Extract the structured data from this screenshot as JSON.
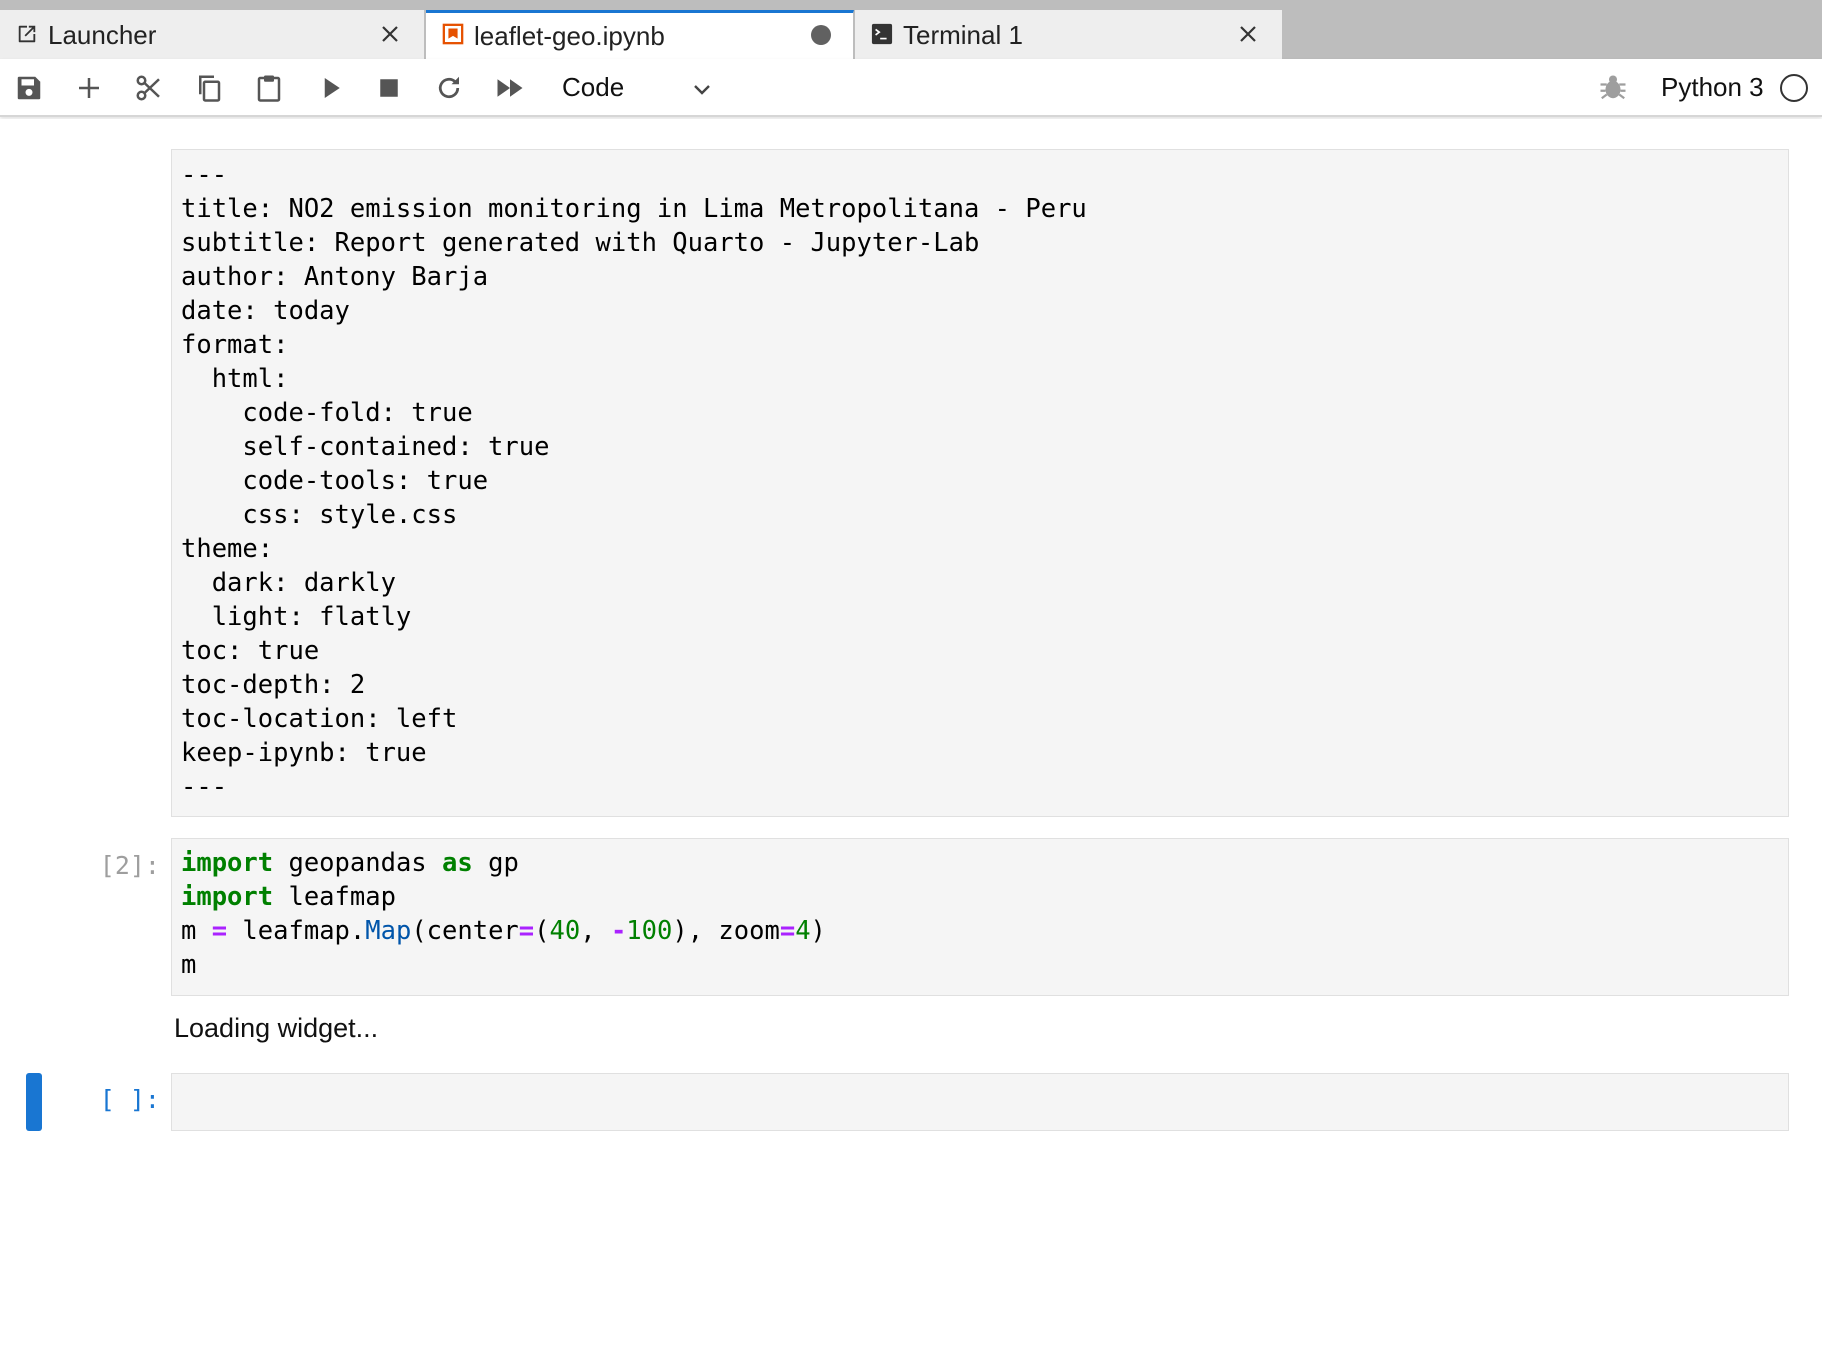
{
  "tabs": [
    {
      "label": "Launcher",
      "icon": "launcher-icon",
      "active": false,
      "closable": true
    },
    {
      "label": "leaflet-geo.ipynb",
      "icon": "notebook-icon",
      "active": true,
      "modified": true
    },
    {
      "label": "Terminal 1",
      "icon": "terminal-icon",
      "active": false,
      "closable": true
    }
  ],
  "toolbar": {
    "cell_type": "Code",
    "kernel_name": "Python 3"
  },
  "cells": {
    "markdown_yaml": {
      "lines": [
        "---",
        "title: NO2 emission monitoring in Lima Metropolitana - Peru",
        "subtitle: Report generated with Quarto - Jupyter-Lab",
        "author: Antony Barja",
        "date: today",
        "format:",
        "  html:",
        "    code-fold: true",
        "    self-contained: true",
        "    code-tools: true",
        "    css: style.css",
        "theme:",
        "  dark: darkly",
        "  light: flatly",
        "toc: true",
        "toc-depth: 2",
        "toc-location: left",
        "keep-ipynb: true",
        "---"
      ]
    },
    "code_cell": {
      "prompt": "[2]:",
      "tokens": {
        "import_kw": "import",
        "geopandas": " geopandas ",
        "as_kw": "as",
        "gp": " gp",
        "leafmap": " leafmap",
        "m": "m ",
        "eq": "=",
        "leafmap_dot": " leafmap.",
        "map_fn": "Map",
        "center_open": "(center",
        "paren_open": "(",
        "n40": "40",
        "comma": ", ",
        "minus": "-",
        "n100": "100",
        "zoom_part": "), zoom",
        "n4": "4",
        "close": ")",
        "m_last": "m"
      },
      "output": "Loading widget..."
    },
    "empty_cell": {
      "prompt": "[ ]:"
    }
  },
  "colors": {
    "accent": "#1976d2",
    "keyword": "#008000",
    "operator": "#aa22ff",
    "function": "#0055aa"
  }
}
